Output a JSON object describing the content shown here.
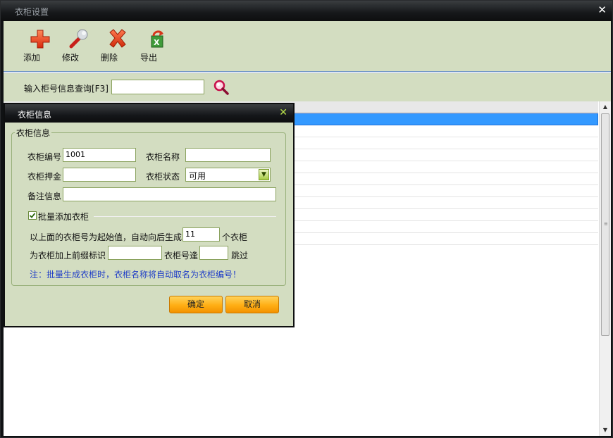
{
  "window": {
    "title": "衣柜设置"
  },
  "toolbar": {
    "add_label": "添加",
    "edit_label": "修改",
    "delete_label": "删除",
    "export_label": "导出"
  },
  "search": {
    "label": "输入柜号信息查询[F3]",
    "value": ""
  },
  "dialog": {
    "title": "衣柜信息",
    "group_legend": "衣柜信息",
    "cabinet_no_label": "衣柜编号",
    "cabinet_no_value": "1001",
    "cabinet_name_label": "衣柜名称",
    "cabinet_name_value": "",
    "deposit_label": "衣柜押金",
    "deposit_value": "",
    "status_label": "衣柜状态",
    "status_value": "可用",
    "remarks_label": "备注信息",
    "remarks_value": "",
    "batch_label": "批量添加衣柜",
    "batch_checked": true,
    "gen_prefix_text": "以上面的衣柜号为起始值，自动向后生成",
    "gen_count_value": "11",
    "gen_suffix_text": "个衣柜",
    "prefix_label": "为衣柜加上前缀标识",
    "prefix_value": "",
    "skip_label": "衣柜号逢",
    "skip_value": "",
    "skip_suffix": "跳过",
    "note": "注：批量生成衣柜时，衣柜名称将自动取名为衣柜编号！",
    "ok_label": "确定",
    "cancel_label": "取消"
  },
  "colors": {
    "panel_bg": "#d3ddc1",
    "selected_row": "#3399ff",
    "note_text": "#1f3dc7",
    "button_orange": "#ffae14",
    "close_x_green": "#b8e04a"
  },
  "icons": {
    "add": "plus-icon",
    "edit": "wrench-icon",
    "delete": "x-icon",
    "export": "excel-export-icon",
    "search": "magnifier-icon",
    "close": "close-icon"
  }
}
